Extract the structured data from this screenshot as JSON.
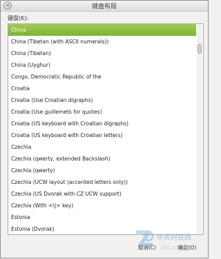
{
  "window": {
    "title": "键盘布局"
  },
  "field": {
    "label": "键盘(K):"
  },
  "list": {
    "items": [
      "China",
      "China (Tibetan (with ASCII numerals))",
      "China (Tibetan)",
      "China (Uyghur)",
      "Congo, Democratic Republic of the",
      "Croatia",
      "Croatia (Use Croatian digraphs)",
      "Croatia (Use guillemets for quotes)",
      "Croatia (US keyboard with Croatian digraphs)",
      "Croatia (US keyboard with Croatian letters)",
      "Czechia",
      "Czechia (qwerty, extended Backslash)",
      "Czechia (qwerty)",
      "Czechia (UCW layout (accented letters only))",
      "Czechia (US Dvorak with CZ UCW support)",
      "Czechia (With <\\|> key)",
      "Estonia",
      "Estonia (Dvorak)"
    ],
    "selected_index": 0
  },
  "buttons": {
    "cancel": "取消(C)",
    "ok": "确定(O)"
  },
  "watermark": {
    "text": "中关村在线",
    "subtext": "zol.com.cn"
  },
  "colors": {
    "selection": "#8cc047",
    "accent": "#5a9ad5"
  }
}
